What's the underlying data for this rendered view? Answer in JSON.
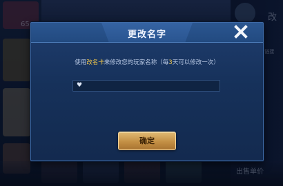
{
  "dialog": {
    "title": "更改名字",
    "message_prefix": "使用",
    "message_item": "改名卡",
    "message_middle": "来修改您的玩家名称（每",
    "message_days": "3",
    "message_suffix": "天可以修改一次）",
    "input_value": "♥",
    "confirm_label": "确定"
  },
  "background": {
    "corner_top_right": "改",
    "corner_label_right": "区/链接",
    "bottom_right_label": "出售单价",
    "top_left_number": "65"
  },
  "colors": {
    "highlight": "#f2c84b",
    "button_gold": "#c49045",
    "dialog_blue": "#1f3d6e"
  }
}
